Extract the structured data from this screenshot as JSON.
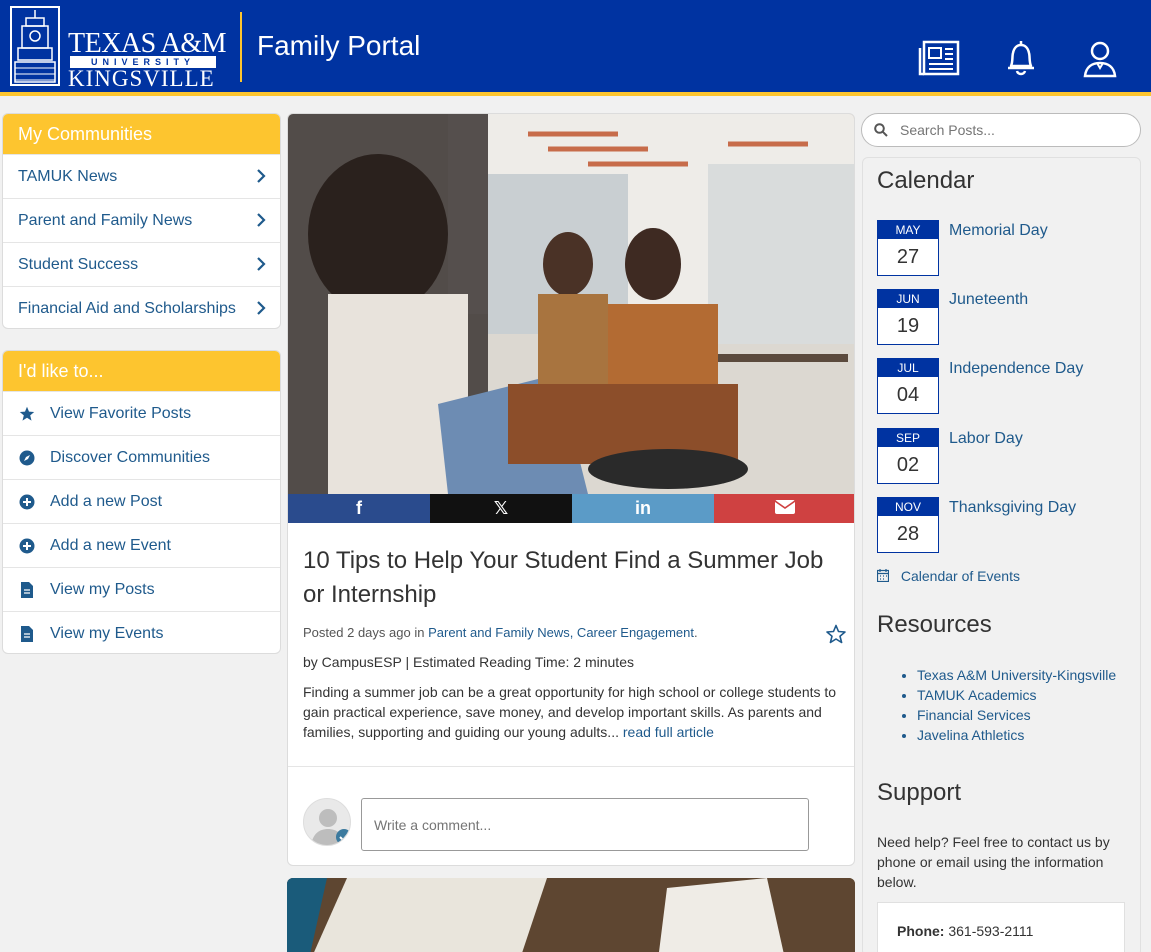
{
  "header": {
    "logo_line1": "TEXAS A&M",
    "logo_line2": "UNIVERSITY",
    "logo_line3": "KINGSVILLE",
    "portal_title": "Family Portal"
  },
  "communities": {
    "title": "My Communities",
    "items": [
      {
        "label": "TAMUK News"
      },
      {
        "label": "Parent and Family News"
      },
      {
        "label": "Student Success"
      },
      {
        "label": "Financial Aid and Scholarships"
      }
    ]
  },
  "actions": {
    "title": "I'd like to...",
    "items": [
      {
        "label": "View Favorite Posts",
        "icon": "star-icon"
      },
      {
        "label": "Discover Communities",
        "icon": "compass-icon"
      },
      {
        "label": "Add a new Post",
        "icon": "plus-circle-icon"
      },
      {
        "label": "Add a new Event",
        "icon": "plus-circle-icon"
      },
      {
        "label": "View my Posts",
        "icon": "document-icon"
      },
      {
        "label": "View my Events",
        "icon": "document-icon"
      }
    ]
  },
  "post": {
    "title": "10 Tips to Help Your Student Find a Summer Job or Internship",
    "posted_prefix": "Posted",
    "posted_time": "2 days ago",
    "posted_in": "in",
    "categories": "Parent and Family News, Career Engagement",
    "author_line": "by CampusESP | Estimated Reading Time: 2 minutes",
    "excerpt": "Finding a summer job can be a great opportunity for high school or college students to gain practical experience, save money, and develop important skills. As parents and families, supporting and guiding our young adults...",
    "read_more": "read full article",
    "share": {
      "facebook": "f",
      "x": "𝕏",
      "linkedin": "in"
    },
    "comment_placeholder": "Write a comment..."
  },
  "search": {
    "placeholder": "Search Posts..."
  },
  "calendar": {
    "title": "Calendar",
    "events": [
      {
        "month": "MAY",
        "day": "27",
        "name": "Memorial Day"
      },
      {
        "month": "JUN",
        "day": "19",
        "name": "Juneteenth"
      },
      {
        "month": "JUL",
        "day": "04",
        "name": "Independence Day"
      },
      {
        "month": "SEP",
        "day": "02",
        "name": "Labor Day"
      },
      {
        "month": "NOV",
        "day": "28",
        "name": "Thanksgiving Day"
      }
    ],
    "link": "Calendar of Events"
  },
  "resources": {
    "title": "Resources",
    "items": [
      "Texas A&M University-Kingsville",
      "TAMUK Academics",
      "Financial Services",
      "Javelina Athletics"
    ]
  },
  "support": {
    "title": "Support",
    "text": "Need help? Feel free to contact us by phone or email using the information below.",
    "phone_label": "Phone:",
    "phone_value": "361-593-2111"
  },
  "colors": {
    "brand_blue": "#0033a1",
    "brand_gold": "#fdc52f",
    "link": "#1f5a8c"
  }
}
